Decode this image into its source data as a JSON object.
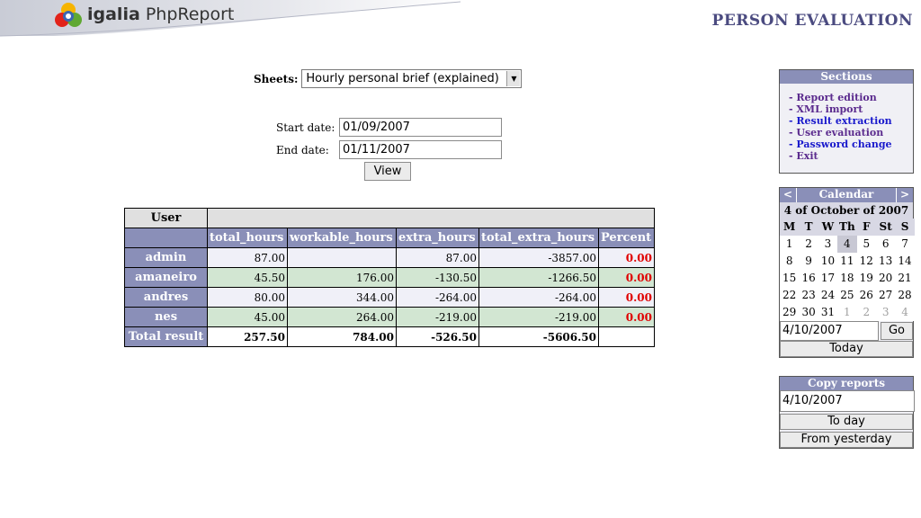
{
  "header": {
    "brand_name": "igalia",
    "brand_product": "PhpReport",
    "page_title": "PERSON EVALUATION"
  },
  "form": {
    "sheets_label": "Sheets:",
    "sheets_selected": "Hourly personal brief (explained)",
    "start_date_label": "Start date:",
    "start_date_value": "01/09/2007",
    "end_date_label": "End date:",
    "end_date_value": "01/11/2007",
    "view_label": "View"
  },
  "report": {
    "user_header": "User",
    "columns": [
      "total_hours",
      "workable_hours",
      "extra_hours",
      "total_extra_hours",
      "Percent"
    ],
    "rows": [
      {
        "user": "admin",
        "cells": [
          "87.00",
          "",
          "87.00",
          "-3857.00",
          "0.00"
        ]
      },
      {
        "user": "amaneiro",
        "cells": [
          "45.50",
          "176.00",
          "-130.50",
          "-1266.50",
          "0.00"
        ]
      },
      {
        "user": "andres",
        "cells": [
          "80.00",
          "344.00",
          "-264.00",
          "-264.00",
          "0.00"
        ]
      },
      {
        "user": "nes",
        "cells": [
          "45.00",
          "264.00",
          "-219.00",
          "-219.00",
          "0.00"
        ]
      }
    ],
    "total": {
      "label": "Total result",
      "cells": [
        "257.50",
        "784.00",
        "-526.50",
        "-5606.50",
        ""
      ]
    }
  },
  "sections": {
    "title": "Sections",
    "items": [
      {
        "label": "- Report edition",
        "state": "visited"
      },
      {
        "label": "- XML import",
        "state": "visited"
      },
      {
        "label": "- Result extraction",
        "state": "active"
      },
      {
        "label": "- User evaluation",
        "state": "visited"
      },
      {
        "label": "- Password change",
        "state": "active"
      },
      {
        "label": "- Exit",
        "state": "visited"
      }
    ]
  },
  "calendar": {
    "prev": "<",
    "next": ">",
    "title": "Calendar",
    "month_label": "4 of October of 2007",
    "weekdays": [
      "M",
      "T",
      "W",
      "Th",
      "F",
      "St",
      "S"
    ],
    "weeks": [
      [
        "1",
        "2",
        "3",
        "4",
        "5",
        "6",
        "7"
      ],
      [
        "8",
        "9",
        "10",
        "11",
        "12",
        "13",
        "14"
      ],
      [
        "15",
        "16",
        "17",
        "18",
        "19",
        "20",
        "21"
      ],
      [
        "22",
        "23",
        "24",
        "25",
        "26",
        "27",
        "28"
      ],
      [
        "29",
        "30",
        "31",
        "1",
        "2",
        "3",
        "4"
      ]
    ],
    "selected_day": "4",
    "date_value": "4/10/2007",
    "go_label": "Go",
    "today_label": "Today"
  },
  "copy_reports": {
    "title": "Copy reports",
    "date_value": "4/10/2007",
    "to_day_label": "To day",
    "from_yesterday_label": "From yesterday"
  },
  "colors": {
    "header_bg": "#8a8fb8",
    "title_color": "#4b4b80",
    "row_odd": "#f0f0f8",
    "row_even": "#d2e6d2",
    "percent_red": "#e00000"
  }
}
